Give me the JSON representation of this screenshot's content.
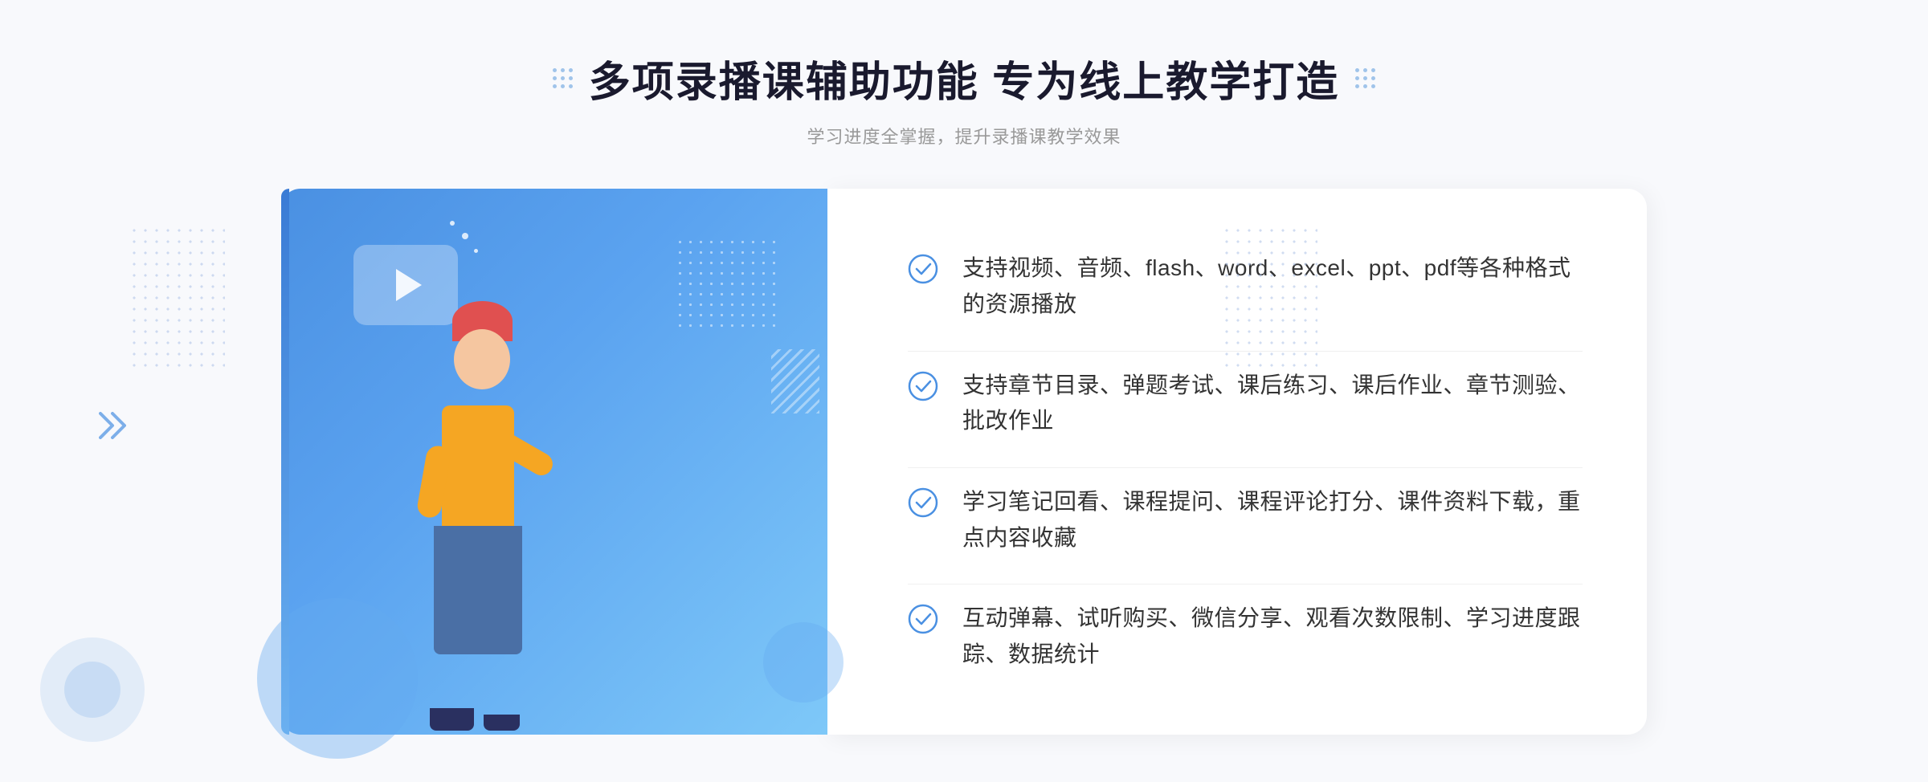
{
  "header": {
    "title": "多项录播课辅助功能 专为线上教学打造",
    "subtitle": "学习进度全掌握，提升录播课教学效果",
    "left_dots_aria": "decorative-dots-left",
    "right_dots_aria": "decorative-dots-right"
  },
  "features": [
    {
      "id": "feature-1",
      "text": "支持视频、音频、flash、word、excel、ppt、pdf等各种格式的资源播放"
    },
    {
      "id": "feature-2",
      "text": "支持章节目录、弹题考试、课后练习、课后作业、章节测验、批改作业"
    },
    {
      "id": "feature-3",
      "text": "学习笔记回看、课程提问、课程评论打分、课件资料下载，重点内容收藏"
    },
    {
      "id": "feature-4",
      "text": "互动弹幕、试听购买、微信分享、观看次数限制、学习进度跟踪、数据统计"
    }
  ],
  "icons": {
    "check_circle": "check-circle-icon",
    "play": "play-icon",
    "chevron_double": "chevron-double-right-icon"
  },
  "colors": {
    "primary": "#4a90e2",
    "light_blue": "#7ec8f8",
    "accent": "#5ba3f0",
    "text_dark": "#1a1a2e",
    "text_gray": "#999",
    "text_body": "#333"
  }
}
